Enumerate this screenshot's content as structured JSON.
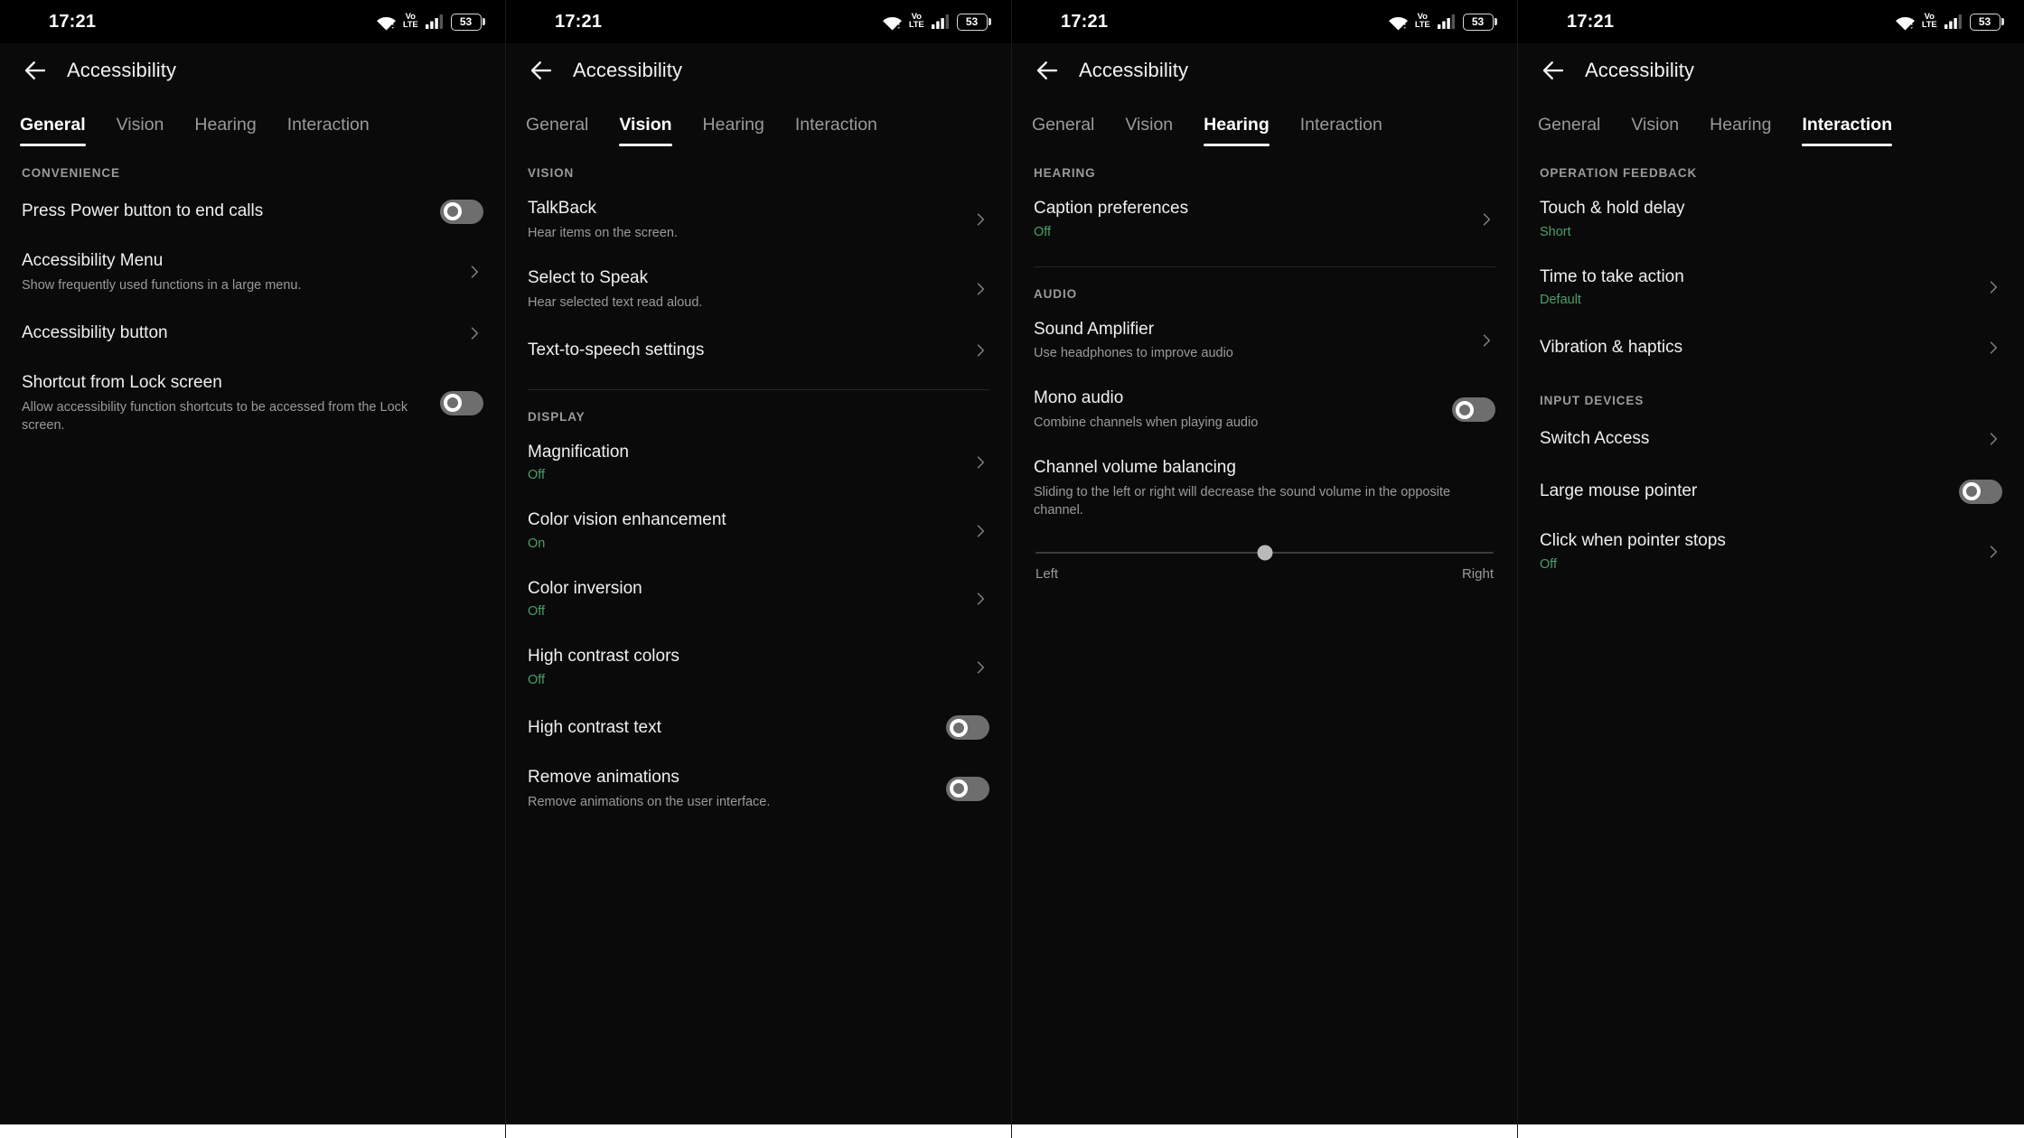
{
  "statusbar": {
    "time": "17:21",
    "battery_percent": "53",
    "volte_line1": "Vo",
    "volte_line2": "LTE",
    "icons": [
      "wifi-icon",
      "volte-icon",
      "signal-icon",
      "battery-icon"
    ]
  },
  "appbar": {
    "title": "Accessibility",
    "back_icon": "back-arrow-icon"
  },
  "colors": {
    "accent_green": "#4e9e69",
    "active_tab": "#ffffff",
    "inactive_tab": "#9a9a9a"
  },
  "tabs": [
    "General",
    "Vision",
    "Hearing",
    "Interaction"
  ],
  "panels": [
    {
      "active_tab": "General",
      "sections": [
        {
          "header": "CONVENIENCE",
          "rows": [
            {
              "title": "Press Power button to end calls",
              "sub": "",
              "value": "",
              "control": "toggle-off"
            },
            {
              "title": "Accessibility Menu",
              "sub": "Show frequently used functions in a large menu.",
              "value": "",
              "control": "chevron"
            },
            {
              "title": "Accessibility button",
              "sub": "",
              "value": "",
              "control": "chevron"
            },
            {
              "title": "Shortcut from Lock screen",
              "sub": "Allow accessibility function shortcuts to be accessed from the Lock screen.",
              "value": "",
              "control": "toggle-off"
            }
          ]
        }
      ]
    },
    {
      "active_tab": "Vision",
      "sections": [
        {
          "header": "VISION",
          "divider_after": true,
          "rows": [
            {
              "title": "TalkBack",
              "sub": "Hear items on the screen.",
              "value": "",
              "control": "chevron"
            },
            {
              "title": "Select to Speak",
              "sub": "Hear selected text read aloud.",
              "value": "",
              "control": "chevron"
            },
            {
              "title": "Text-to-speech settings",
              "sub": "",
              "value": "",
              "control": "chevron"
            }
          ]
        },
        {
          "header": "DISPLAY",
          "rows": [
            {
              "title": "Magnification",
              "sub": "",
              "value": "Off",
              "control": "chevron"
            },
            {
              "title": "Color vision enhancement",
              "sub": "",
              "value": "On",
              "control": "chevron"
            },
            {
              "title": "Color inversion",
              "sub": "",
              "value": "Off",
              "control": "chevron"
            },
            {
              "title": "High contrast colors",
              "sub": "",
              "value": "Off",
              "control": "chevron"
            },
            {
              "title": "High contrast text",
              "sub": "",
              "value": "",
              "control": "toggle-off"
            },
            {
              "title": "Remove animations",
              "sub": "Remove animations on the user interface.",
              "value": "",
              "control": "toggle-off"
            }
          ]
        }
      ]
    },
    {
      "active_tab": "Hearing",
      "sections": [
        {
          "header": "HEARING",
          "divider_after": true,
          "rows": [
            {
              "title": "Caption preferences",
              "sub": "",
              "value": "Off",
              "control": "chevron"
            }
          ]
        },
        {
          "header": "AUDIO",
          "rows": [
            {
              "title": "Sound Amplifier",
              "sub": "Use headphones to improve audio",
              "value": "",
              "control": "chevron"
            },
            {
              "title": "Mono audio",
              "sub": "Combine channels when playing audio",
              "value": "",
              "control": "toggle-off"
            },
            {
              "title": "Channel volume balancing",
              "sub": "Sliding to the left or right will decrease the sound volume in the opposite channel.",
              "value": "",
              "control": "none",
              "slider": {
                "position_percent": 50,
                "left_label": "Left",
                "right_label": "Right"
              }
            }
          ]
        }
      ]
    },
    {
      "active_tab": "Interaction",
      "sections": [
        {
          "header": "OPERATION FEEDBACK",
          "rows": [
            {
              "title": "Touch & hold delay",
              "sub": "",
              "value": "Short",
              "control": "none"
            },
            {
              "title": "Time to take action",
              "sub": "",
              "value": "Default",
              "control": "chevron"
            },
            {
              "title": "Vibration & haptics",
              "sub": "",
              "value": "",
              "control": "chevron"
            }
          ]
        },
        {
          "header": "INPUT DEVICES",
          "rows": [
            {
              "title": "Switch Access",
              "sub": "",
              "value": "",
              "control": "chevron"
            },
            {
              "title": "Large mouse pointer",
              "sub": "",
              "value": "",
              "control": "toggle-off"
            },
            {
              "title": "Click when pointer stops",
              "sub": "",
              "value": "Off",
              "control": "chevron"
            }
          ]
        }
      ]
    }
  ]
}
